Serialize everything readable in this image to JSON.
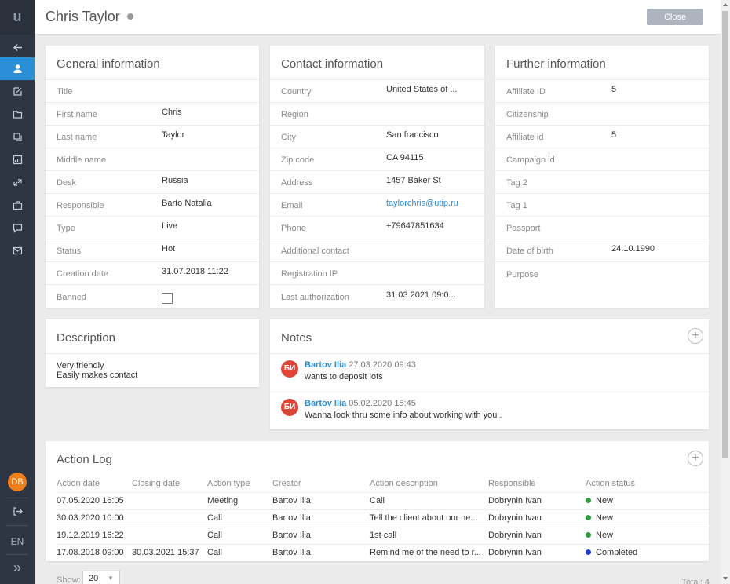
{
  "app": {
    "logo": "u"
  },
  "sidebar": {
    "items": [
      {
        "icon": "arrow-left-icon"
      },
      {
        "icon": "user-icon",
        "active": true
      },
      {
        "icon": "edit-icon"
      },
      {
        "icon": "folder-icon"
      },
      {
        "icon": "copy-icon"
      },
      {
        "icon": "chart-icon"
      },
      {
        "icon": "transfer-icon"
      },
      {
        "icon": "briefcase-icon"
      },
      {
        "icon": "chat-icon"
      },
      {
        "icon": "mail-icon"
      }
    ],
    "avatar_initials": "DB",
    "language": "EN",
    "logout_icon": "logout-icon",
    "expand_icon": "double-chevron-right-icon"
  },
  "header": {
    "title": "Chris Taylor",
    "close_label": "Close"
  },
  "general": {
    "title": "General information",
    "rows": [
      {
        "label": "Title",
        "value": ""
      },
      {
        "label": "First name",
        "value": "Chris"
      },
      {
        "label": "Last name",
        "value": "Taylor"
      },
      {
        "label": "Middle name",
        "value": ""
      },
      {
        "label": "Desk",
        "value": "Russia"
      },
      {
        "label": "Responsible",
        "value": "Barto Natalia"
      },
      {
        "label": "Type",
        "value": "Live"
      },
      {
        "label": "Status",
        "value": "Hot"
      },
      {
        "label": "Creation date",
        "value": "31.07.2018 11:22"
      },
      {
        "label": "Banned",
        "value": ""
      }
    ]
  },
  "contact": {
    "title": "Contact information",
    "rows": [
      {
        "label": "Country",
        "value": "United States of ..."
      },
      {
        "label": "Region",
        "value": ""
      },
      {
        "label": "City",
        "value": "San francisco"
      },
      {
        "label": "Zip code",
        "value": "CA 94115"
      },
      {
        "label": "Address",
        "value": "1457 Baker St"
      },
      {
        "label": "Email",
        "value": "taylorchris@utip.ru"
      },
      {
        "label": "Phone",
        "value": "+79647851634"
      },
      {
        "label": "Additional contact",
        "value": ""
      },
      {
        "label": "Registration IP",
        "value": ""
      },
      {
        "label": "Last authorization",
        "value": "31.03.2021 09:0..."
      }
    ]
  },
  "further": {
    "title": "Further information",
    "rows": [
      {
        "label": "Affiliate ID",
        "value": "5"
      },
      {
        "label": "Citizenship",
        "value": ""
      },
      {
        "label": "Affiliate id",
        "value": "5"
      },
      {
        "label": "Campaign id",
        "value": ""
      },
      {
        "label": "Tag 2",
        "value": ""
      },
      {
        "label": "Tag 1",
        "value": ""
      },
      {
        "label": "Passport",
        "value": ""
      },
      {
        "label": "Date of birth",
        "value": "24.10.1990"
      },
      {
        "label": "Purpose",
        "value": ""
      }
    ]
  },
  "description": {
    "title": "Description",
    "line1": "Very friendly",
    "line2": "Easily makes contact"
  },
  "notes": {
    "title": "Notes",
    "items": [
      {
        "initials": "БИ",
        "author": "Bartov Ilia",
        "time": "27.03.2020 09:43",
        "text": "wants to deposit lots"
      },
      {
        "initials": "БИ",
        "author": "Bartov Ilia",
        "time": "05.02.2020 15:45",
        "text": "Wanna look thru some info about working with you ."
      }
    ]
  },
  "action_log": {
    "title": "Action Log",
    "columns": [
      "Action date",
      "Closing date",
      "Action type",
      "Creator",
      "Action description",
      "Responsible",
      "Action status"
    ],
    "rows": [
      [
        "07.05.2020 16:05",
        "",
        "Meeting",
        "Bartov Ilia",
        "Call",
        "Dobrynin Ivan",
        "New"
      ],
      [
        "30.03.2020 10:00",
        "",
        "Call",
        "Bartov Ilia",
        "Tell the client about our ne...",
        "Dobrynin Ivan",
        "New"
      ],
      [
        "19.12.2019 16:22",
        "",
        "Call",
        "Bartov Ilia",
        "1st call",
        "Dobrynin Ivan",
        "New"
      ],
      [
        "17.08.2018 09:00",
        "30.03.2021 15:37",
        "Call",
        "Bartov Ilia",
        "Remind me of the need to r...",
        "Dobrynin Ivan",
        "Completed"
      ]
    ],
    "status_colors": {
      "New": "#2e9e3e",
      "Completed": "#1f3fd6"
    }
  },
  "footer": {
    "show_label": "Show:",
    "page_size": "20",
    "total": "Total: 4"
  },
  "colors": {
    "sidebar": "#2e3644",
    "accent": "#2a8fd6",
    "avatar": "#ee7d1b",
    "note_avatar": "#e0453a"
  }
}
